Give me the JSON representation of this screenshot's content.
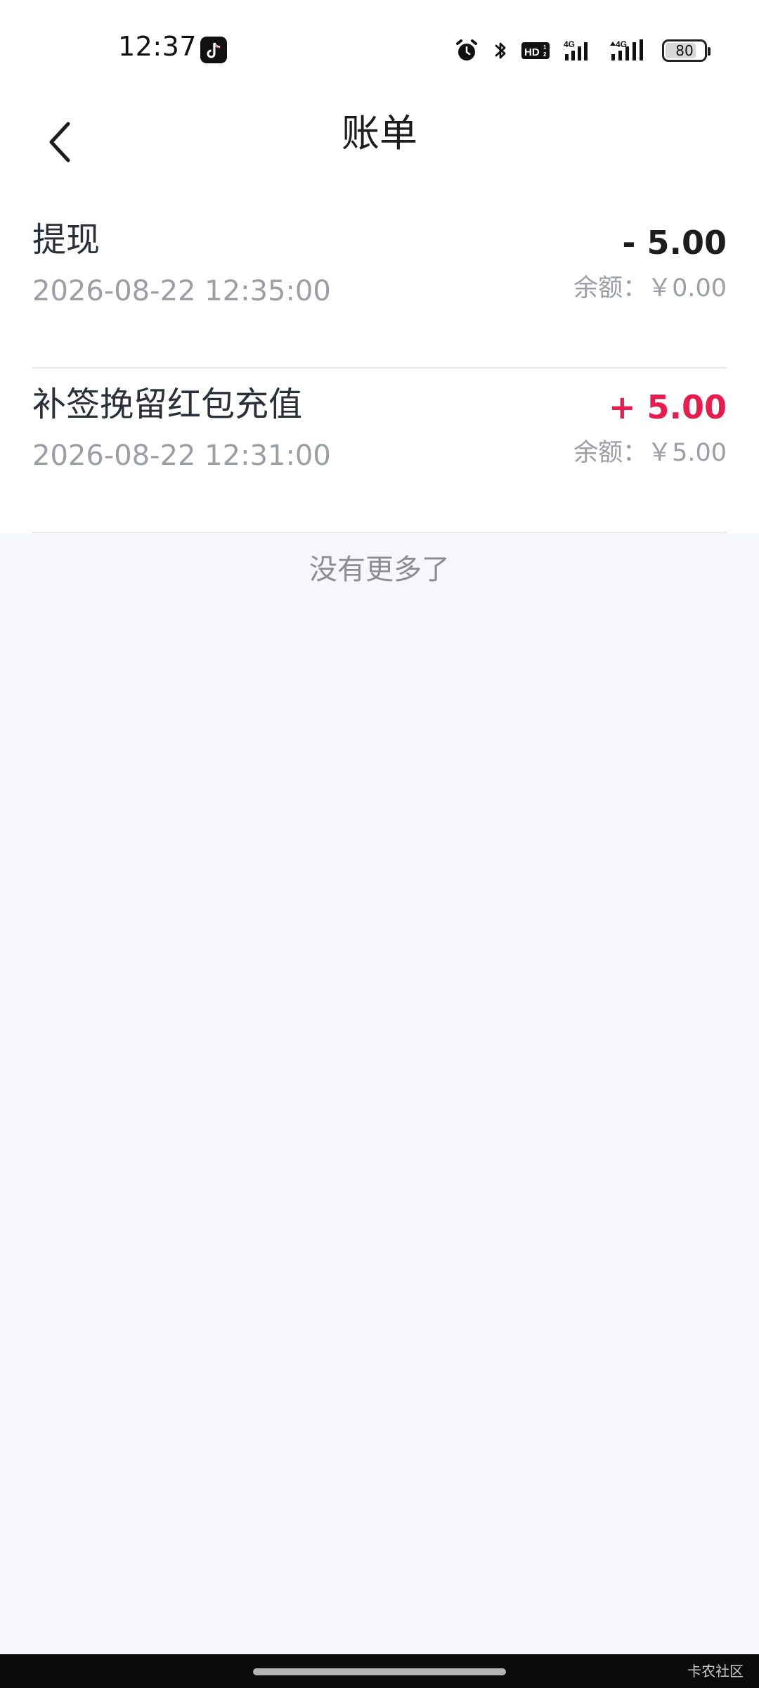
{
  "status_bar": {
    "time": "12:37",
    "battery_level": "80",
    "icons": [
      "tiktok-icon",
      "alarm-icon",
      "bluetooth-icon",
      "hd-icon",
      "4g-signal-icon",
      "4g-signal-icon",
      "battery-icon"
    ]
  },
  "header": {
    "title": "账单"
  },
  "records": [
    {
      "title": "提现",
      "time": "2026-08-22 12:35:00",
      "amount": "- 5.00",
      "balance": "余额：￥0.00",
      "type": "expense"
    },
    {
      "title": "补签挽留红包充值",
      "time": "2026-08-22 12:31:00",
      "amount": "+ 5.00",
      "balance": "余额：￥5.00",
      "type": "income"
    }
  ],
  "footer": {
    "no_more": "没有更多了"
  },
  "watermark": "卡农社区",
  "colors": {
    "income": "#ea1c4f",
    "background": "#f6f7fb"
  }
}
